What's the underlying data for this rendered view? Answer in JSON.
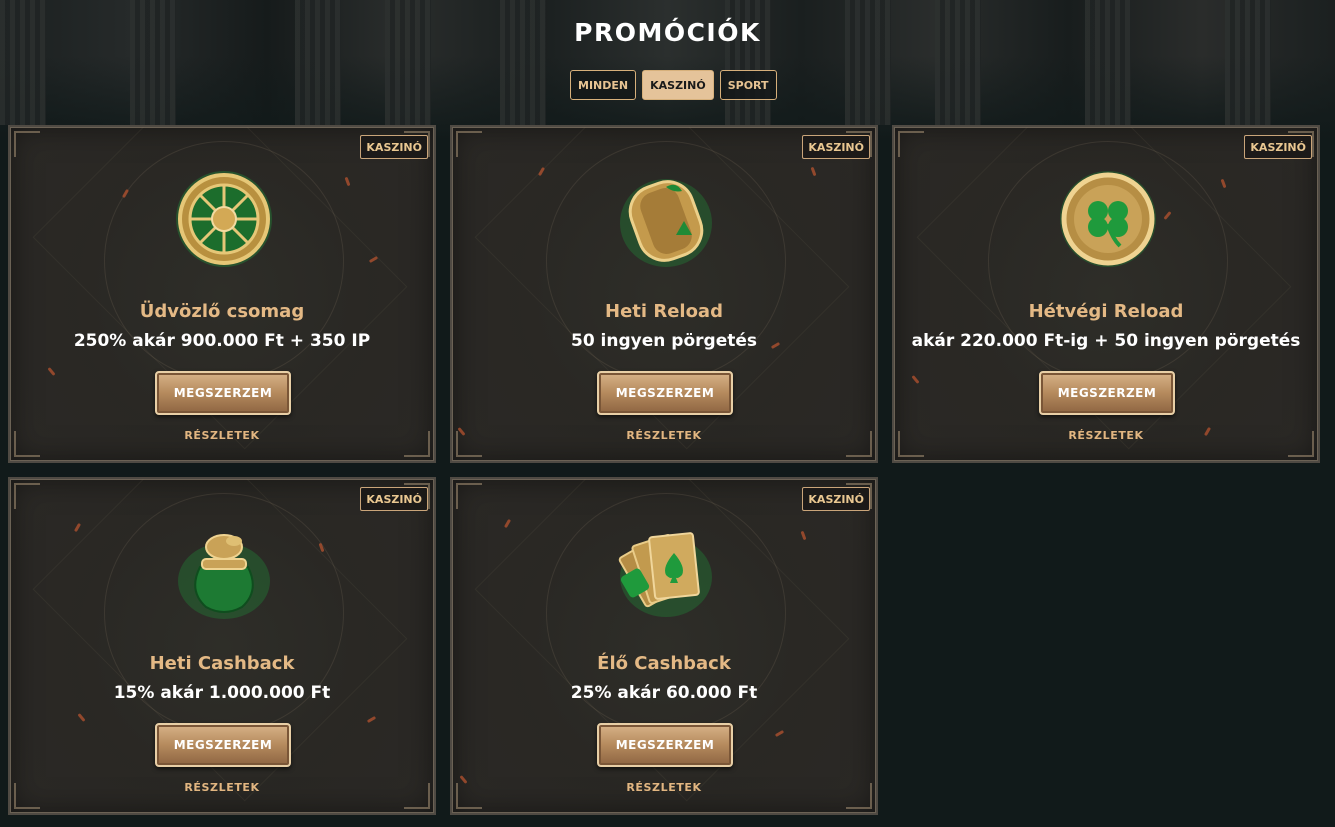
{
  "header": {
    "title": "PROMÓCIÓK"
  },
  "filters": [
    {
      "label": "MINDEN",
      "active": false
    },
    {
      "label": "KASZINÓ",
      "active": true
    },
    {
      "label": "SPORT",
      "active": false
    }
  ],
  "cards": [
    {
      "badge": "KASZINÓ",
      "icon": "roulette-wheel-icon",
      "title": "Üdvözlő csomag",
      "subtitle": "250% akár 900.000 Ft + 350 IP",
      "cta": "MEGSZERZEM",
      "details": "RÉSZLETEK"
    },
    {
      "badge": "KASZINÓ",
      "icon": "slot-reel-icon",
      "title": "Heti Reload",
      "subtitle": "50 ingyen pörgetés",
      "cta": "MEGSZERZEM",
      "details": "RÉSZLETEK"
    },
    {
      "badge": "KASZINÓ",
      "icon": "clover-coin-icon",
      "title": "Hétvégi Reload",
      "subtitle": "akár 220.000 Ft-ig + 50 ingyen pörgetés",
      "cta": "MEGSZERZEM",
      "details": "RÉSZLETEK"
    },
    {
      "badge": "KASZINÓ",
      "icon": "money-bag-icon",
      "title": "Heti Cashback",
      "subtitle": "15% akár 1.000.000 Ft",
      "cta": "MEGSZERZEM",
      "details": "RÉSZLETEK"
    },
    {
      "badge": "KASZINÓ",
      "icon": "playing-cards-icon",
      "title": "Élő Cashback",
      "subtitle": "25% akár 60.000 Ft",
      "cta": "MEGSZERZEM",
      "details": "RÉSZLETEK"
    }
  ],
  "colors": {
    "gold": "#e4b985",
    "accent_green": "#1f9a3c",
    "background": "#111a1a"
  }
}
